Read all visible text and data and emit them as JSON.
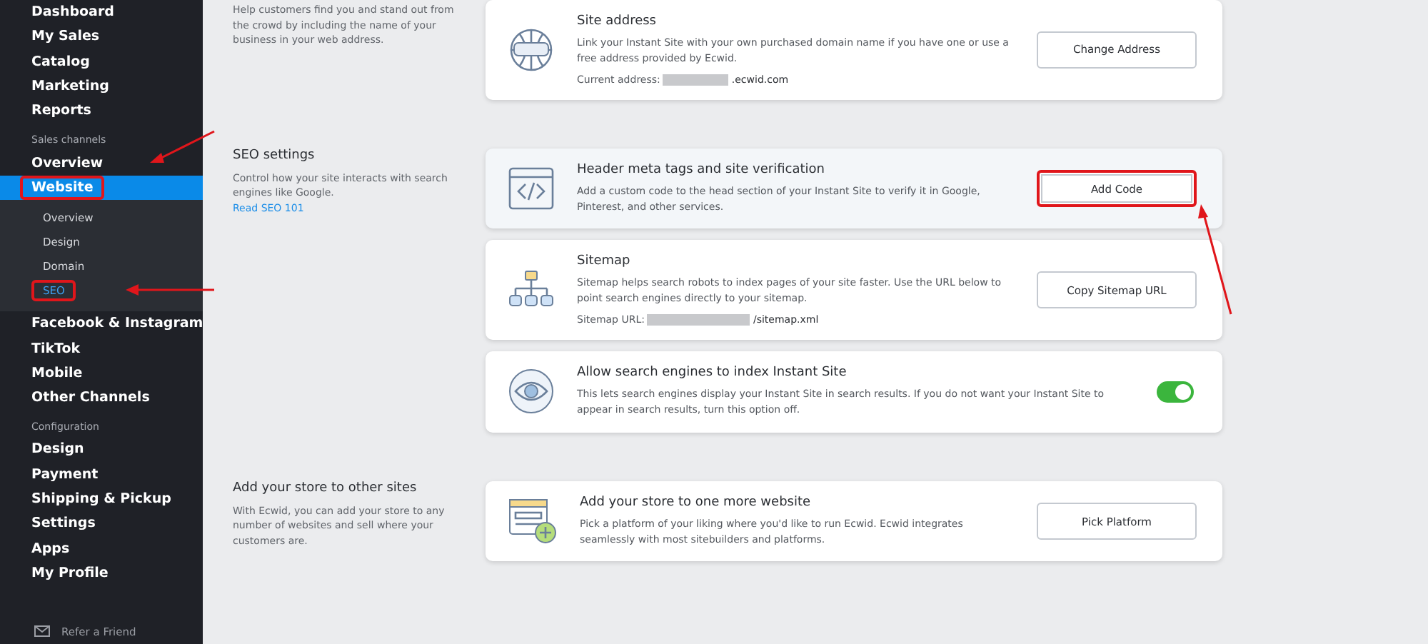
{
  "sidebar": {
    "items": [
      {
        "kind": "item",
        "label": "Dashboard",
        "selected": false,
        "highlighted": false
      },
      {
        "kind": "item",
        "label": "My Sales",
        "selected": false,
        "highlighted": false
      },
      {
        "kind": "item",
        "label": "Catalog",
        "selected": false,
        "highlighted": false
      },
      {
        "kind": "item",
        "label": "Marketing",
        "selected": false,
        "highlighted": false
      },
      {
        "kind": "item",
        "label": "Reports",
        "selected": false,
        "highlighted": false
      },
      {
        "kind": "heading",
        "label": "Sales channels"
      },
      {
        "kind": "item",
        "label": "Overview",
        "selected": false,
        "highlighted": false
      },
      {
        "kind": "item",
        "label": "Website",
        "selected": true,
        "highlighted": true,
        "expanded": true,
        "children": [
          {
            "label": "Overview",
            "selected": false,
            "highlighted": false
          },
          {
            "label": "Design",
            "selected": false,
            "highlighted": false
          },
          {
            "label": "Domain",
            "selected": false,
            "highlighted": false
          },
          {
            "label": "SEO",
            "selected": true,
            "highlighted": true
          }
        ]
      },
      {
        "kind": "item",
        "label": "Facebook & Instagram",
        "selected": false,
        "highlighted": false
      },
      {
        "kind": "item",
        "label": "TikTok",
        "selected": false,
        "highlighted": false
      },
      {
        "kind": "item",
        "label": "Mobile",
        "selected": false,
        "highlighted": false
      },
      {
        "kind": "item",
        "label": "Other Channels",
        "selected": false,
        "highlighted": false
      },
      {
        "kind": "heading",
        "label": "Configuration"
      },
      {
        "kind": "item",
        "label": "Design",
        "selected": false,
        "highlighted": false
      },
      {
        "kind": "item",
        "label": "Payment",
        "selected": false,
        "highlighted": false
      },
      {
        "kind": "item",
        "label": "Shipping & Pickup",
        "selected": false,
        "highlighted": false
      },
      {
        "kind": "item",
        "label": "Settings",
        "selected": false,
        "highlighted": false
      },
      {
        "kind": "item",
        "label": "Apps",
        "selected": false,
        "highlighted": false
      },
      {
        "kind": "item",
        "label": "My Profile",
        "selected": false,
        "highlighted": false
      }
    ],
    "footer_link": "Refer a Friend"
  },
  "sections": [
    {
      "description": "Help customers find you and stand out from the crowd by including the name of your business in your web address.",
      "cards": [
        {
          "kind": "globe",
          "title": "Site address",
          "text": "Link your Instant Site with your own purchased domain name if you have one or use a free address provided by Ecwid.",
          "address_label": "Current address:",
          "address_suffix": ".ecwid.com",
          "action": {
            "kind": "button",
            "label": "Change Address",
            "highlighted": false
          }
        }
      ]
    },
    {
      "title": "SEO settings",
      "description": "Control how your site interacts with search engines like Google.",
      "link": "Read SEO 101",
      "cards": [
        {
          "kind": "code",
          "title": "Header meta tags and site verification",
          "text": "Add a custom code to the head section of your Instant Site to verify it in Google, Pinterest, and other services.",
          "tinted": true,
          "action": {
            "kind": "button",
            "label": "Add Code",
            "highlighted": true
          }
        },
        {
          "kind": "sitemap",
          "title": "Sitemap",
          "text": "Sitemap helps search robots to index pages of your site faster. Use the URL below to point search engines directly to your sitemap.",
          "address_label": "Sitemap URL:",
          "address_suffix": "/sitemap.xml",
          "action": {
            "kind": "button",
            "label": "Copy Sitemap URL",
            "highlighted": false
          }
        },
        {
          "kind": "eye",
          "title": "Allow search engines to index Instant Site",
          "text": "This lets search engines display your Instant Site in search results. If you do not want your Instant Site to appear in search results, turn this option off.",
          "action": {
            "kind": "toggle",
            "on": true
          }
        }
      ]
    },
    {
      "title": "Add your store to other sites",
      "description": "With Ecwid, you can add your store to any number of websites and sell where your customers are.",
      "cards": [
        {
          "kind": "browser-plus",
          "title": "Add your store to one more website",
          "text": "Pick a platform of your liking where you'd like to run Ecwid. Ecwid integrates seamlessly with most sitebuilders and platforms.",
          "action": {
            "kind": "button",
            "label": "Pick Platform",
            "highlighted": false
          }
        }
      ]
    }
  ]
}
